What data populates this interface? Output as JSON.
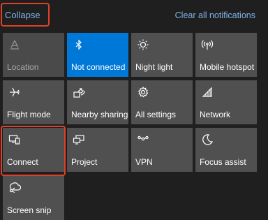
{
  "header": {
    "collapse_label": "Collapse",
    "clear_all_label": "Clear all notifications"
  },
  "tiles": [
    {
      "label": "Location",
      "icon": "location-icon",
      "state": "disabled"
    },
    {
      "label": "Not connected",
      "icon": "bluetooth-icon",
      "state": "active"
    },
    {
      "label": "Night light",
      "icon": "night-light-icon",
      "state": "normal"
    },
    {
      "label": "Mobile hotspot",
      "icon": "mobile-hotspot-icon",
      "state": "normal"
    },
    {
      "label": "Flight mode",
      "icon": "airplane-icon",
      "state": "normal"
    },
    {
      "label": "Nearby sharing",
      "icon": "nearby-sharing-icon",
      "state": "normal"
    },
    {
      "label": "All settings",
      "icon": "gear-icon",
      "state": "normal"
    },
    {
      "label": "Network",
      "icon": "network-icon",
      "state": "normal"
    },
    {
      "label": "Connect",
      "icon": "connect-icon",
      "state": "normal"
    },
    {
      "label": "Project",
      "icon": "project-icon",
      "state": "normal"
    },
    {
      "label": "VPN",
      "icon": "vpn-icon",
      "state": "normal"
    },
    {
      "label": "Focus assist",
      "icon": "moon-icon",
      "state": "normal"
    },
    {
      "label": "Screen snip",
      "icon": "screen-snip-icon",
      "state": "normal"
    }
  ],
  "colors": {
    "background": "#1f1f1f",
    "tile": "#505050",
    "tile_active": "#0078d7",
    "link": "#7fb3e6",
    "highlight": "#e0402a"
  }
}
